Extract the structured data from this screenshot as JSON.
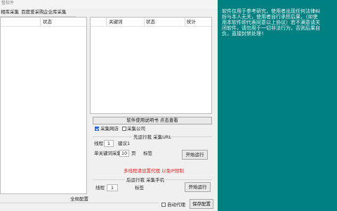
{
  "window": {
    "title": "整软件"
  },
  "tabs": [
    "相库采集",
    "百度爱采购",
    "企业库采集"
  ],
  "left_list": {
    "headers": [
      "",
      "状态"
    ],
    "footer_label": "全局配置"
  },
  "right_list": {
    "headers": [
      "",
      "关键词",
      "状态",
      "统计"
    ]
  },
  "manual_button": "软件使用说明书 点击查看",
  "options": {
    "collect_shop": {
      "label": "采集网店",
      "checked": true
    },
    "collect_company": {
      "label": "采集公司",
      "checked": false
    }
  },
  "url_section": {
    "title": "先运行我 采集URL",
    "thread_label": "线程",
    "thread_value": "1",
    "thread_hint": "建议1",
    "keyword_pages_label": "单关键词采集",
    "pages_value": "10",
    "pages_unit": "页",
    "tag_label": "标签",
    "run_button": "开始运行"
  },
  "warning_text": "多线程请设置代理 以免IP限制",
  "phone_section": {
    "title": "后运行我 采集手机",
    "thread_label": "线程",
    "thread_value": "1",
    "tag_label": "标签",
    "run_button": "开始运行"
  },
  "footer": {
    "auto_proxy": {
      "label": "自动代理",
      "checked": false
    },
    "save_button": "保存配置"
  },
  "console": {
    "lines": [
      "软件仅用于参考研究，使用者出现任何法律纠",
      "纷与本人无关，使用者自行承担后果，（如使",
      "用本软件即代表同意以上协议）若不满意请关",
      "闭软件，请勿用于一切非法行为，否则后果自",
      "负，直接封禁处理!"
    ]
  },
  "colors": {
    "console_bg": "#008080",
    "warning": "#e02424",
    "checkbox_checked": "#1e64d2"
  }
}
